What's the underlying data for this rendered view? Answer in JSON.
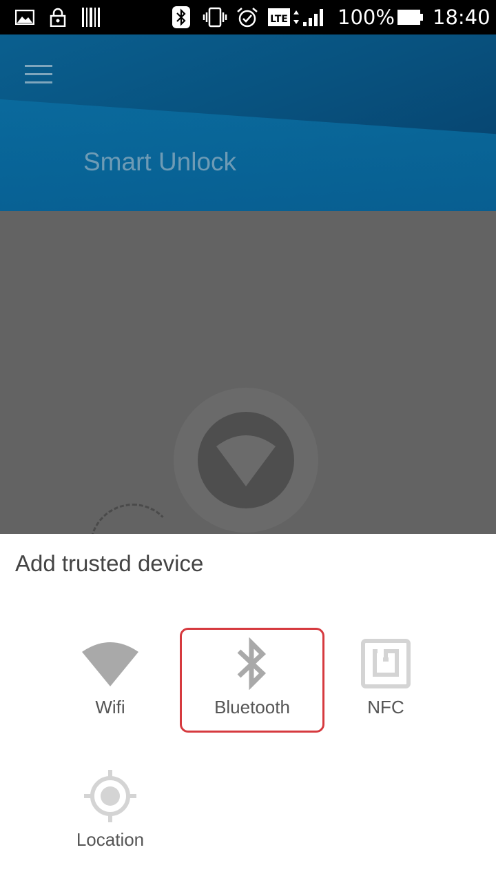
{
  "status_bar": {
    "battery_text": "100%",
    "time": "18:40",
    "network_label": "LTE",
    "icons": [
      "image-icon",
      "lock-icon",
      "barcode-icon",
      "bluetooth-icon",
      "vibrate-icon",
      "alarm-icon",
      "lte-icon",
      "signal-icon",
      "battery-icon"
    ]
  },
  "header": {
    "title": "Smart Unlock",
    "menu_icon": "hamburger-menu-icon"
  },
  "background": {
    "center_icon": "wifi-icon"
  },
  "sheet": {
    "title": "Add trusted device",
    "options": [
      {
        "label": "Wifi",
        "icon": "wifi-icon",
        "selected": false
      },
      {
        "label": "Bluetooth",
        "icon": "bluetooth-icon",
        "selected": true
      },
      {
        "label": "NFC",
        "icon": "nfc-icon",
        "selected": false
      },
      {
        "label": "Location",
        "icon": "location-icon",
        "selected": false
      }
    ]
  },
  "colors": {
    "header_blue": "#08527f",
    "selection_red": "#d63a3f",
    "icon_gray": "#a9a9a9",
    "dim_gray": "#636363"
  }
}
